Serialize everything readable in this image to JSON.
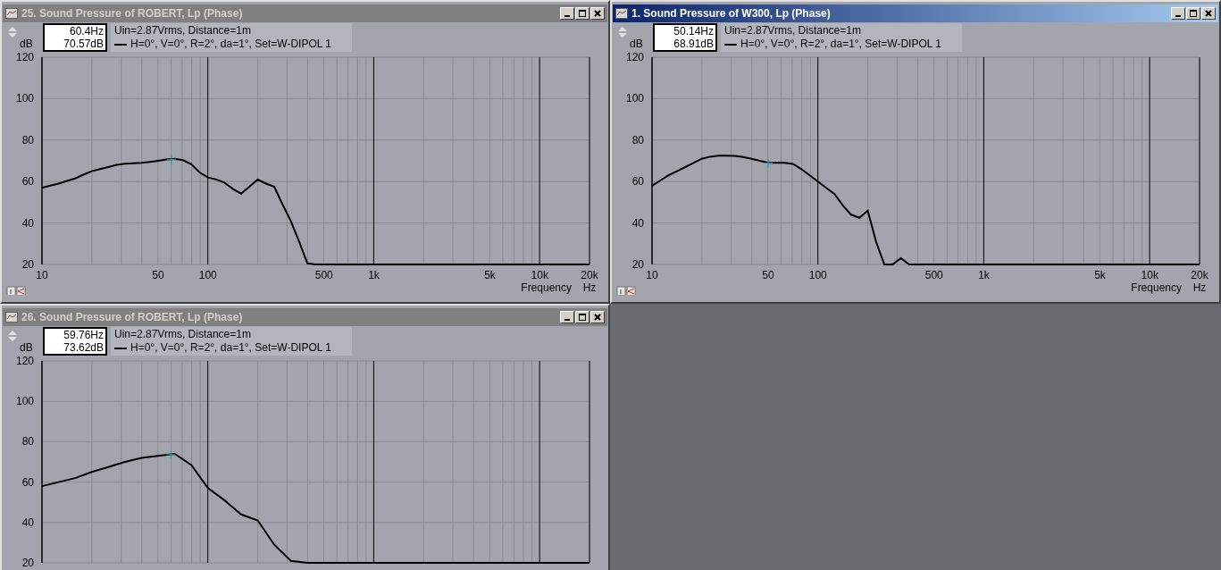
{
  "windows": [
    {
      "title": "25. Sound Pressure of ROBERT, Lp (Phase)",
      "active": false,
      "y_unit": "dB",
      "x_unit": "Hz",
      "cursor": {
        "frequency": "60.4Hz",
        "level": "70.57dB"
      },
      "conditions": "Uin=2.87Vrms, Distance=1m",
      "chart_data": {
        "type": "line",
        "xlabel": "Frequency",
        "ylim": [
          20,
          120
        ],
        "grid": true,
        "yticks": [
          20,
          40,
          60,
          80,
          100,
          120
        ],
        "categories": [
          "10",
          null,
          null,
          null,
          null,
          null,
          null,
          null,
          null,
          null,
          null,
          null,
          null,
          null,
          "50",
          null,
          null,
          null,
          null,
          null,
          "100",
          null,
          null,
          null,
          null,
          null,
          null,
          null,
          null,
          null,
          null,
          null,
          null,
          null,
          "500",
          null,
          null,
          null,
          null,
          null,
          "1k",
          null,
          null,
          null,
          null,
          null,
          null,
          null,
          null,
          null,
          null,
          null,
          null,
          null,
          "5k",
          null,
          null,
          null,
          null,
          null,
          "10k",
          null,
          null,
          null,
          null,
          null,
          "20k"
        ],
        "series": [
          {
            "name": "H=0°, V=0°, R=2°, da=1°, Set=W-DIPOL 1",
            "color": "#000000",
            "values": [
              57,
              58,
              59,
              60.3,
              61.5,
              63.3,
              65,
              66,
              67,
              68,
              68.6,
              68.8,
              69,
              69.5,
              70,
              70.6,
              71,
              70.3,
              68.3,
              64.4,
              62,
              61,
              59.5,
              56.5,
              54.2,
              57.5,
              61,
              59,
              57.5,
              49,
              41,
              31,
              20.5,
              20,
              20,
              20,
              20,
              20,
              20,
              20,
              20,
              20,
              20,
              20,
              20,
              20,
              20,
              20,
              20,
              20,
              20,
              20,
              20,
              20,
              20,
              20,
              20,
              20,
              20,
              20,
              20,
              20,
              20,
              20,
              20,
              20,
              20
            ]
          }
        ]
      }
    },
    {
      "title": "1. Sound Pressure of W300, Lp (Phase)",
      "active": true,
      "y_unit": "dB",
      "x_unit": "Hz",
      "cursor": {
        "frequency": "50.14Hz",
        "level": "68.91dB"
      },
      "conditions": "Uin=2.87Vrms, Distance=1m",
      "chart_data": {
        "type": "line",
        "xlabel": "Frequency",
        "ylim": [
          20,
          120
        ],
        "grid": true,
        "yticks": [
          20,
          40,
          60,
          80,
          100,
          120
        ],
        "categories": [
          "10",
          null,
          null,
          null,
          null,
          null,
          null,
          null,
          null,
          null,
          null,
          null,
          null,
          null,
          "50",
          null,
          null,
          null,
          null,
          null,
          "100",
          null,
          null,
          null,
          null,
          null,
          null,
          null,
          null,
          null,
          null,
          null,
          null,
          null,
          "500",
          null,
          null,
          null,
          null,
          null,
          "1k",
          null,
          null,
          null,
          null,
          null,
          null,
          null,
          null,
          null,
          null,
          null,
          null,
          null,
          "5k",
          null,
          null,
          null,
          null,
          null,
          "10k",
          null,
          null,
          null,
          null,
          null,
          "20k"
        ],
        "series": [
          {
            "name": "H=0°, V=0°, R=2°, da=1°, Set=W-DIPOL 1",
            "color": "#000000",
            "values": [
              58,
              60.5,
              63,
              65,
              67,
              69,
              71,
              72,
              72.5,
              72.5,
              72.4,
              71.8,
              71,
              70,
              69,
              69,
              69,
              68.5,
              66,
              63,
              60,
              57,
              54,
              48.5,
              44,
              42.5,
              46,
              31,
              20,
              20,
              23,
              20,
              20,
              20,
              20,
              20,
              20,
              20,
              20,
              20,
              20,
              20,
              20,
              20,
              20,
              20,
              20,
              20,
              20,
              20,
              20,
              20,
              20,
              20,
              20,
              20,
              20,
              20,
              20,
              20,
              20,
              20,
              20,
              20,
              20,
              20,
              20
            ]
          }
        ]
      }
    },
    {
      "title": "26. Sound Pressure of ROBERT, Lp (Phase)",
      "active": false,
      "y_unit": "dB",
      "cursor": {
        "frequency": "59.76Hz",
        "level": "73.62dB"
      },
      "conditions": "Uin=2.87Vrms, Distance=1m",
      "chart_data": {
        "type": "line",
        "ylim": [
          20,
          120
        ],
        "grid": true,
        "yticks": [
          20,
          40,
          60,
          80,
          100,
          120
        ],
        "series": [
          {
            "name": "H=0°, V=0°, R=2°, da=1°, Set=W-DIPOL 1",
            "color": "#000000",
            "values": [
              58,
              60,
              62,
              65,
              67.5,
              70,
              72,
              73,
              74,
              68.5,
              57,
              51,
              44,
              41,
              29,
              21,
              20,
              20,
              20,
              20,
              20,
              20,
              20,
              20,
              20,
              20,
              20,
              20,
              20,
              20,
              20,
              20,
              20,
              20
            ]
          }
        ]
      }
    }
  ]
}
